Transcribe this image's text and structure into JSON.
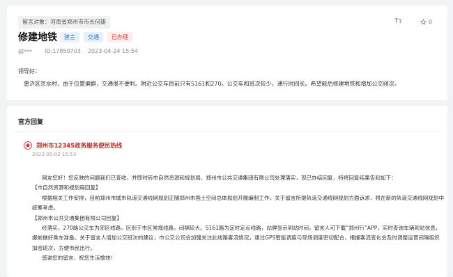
{
  "message": {
    "target": "留言对象：河南省郑州市市长何雄",
    "title": "修建地铁",
    "tags": [
      "建言",
      "交通",
      "已办理"
    ],
    "font_size_label": "Tт",
    "like_count": "0",
    "user": "郝***",
    "id": "ID:17850703",
    "datetime": "2023-04-24 15:54",
    "greeting": "领导好：",
    "content": "惠济区京水村，由于位置偏僻，交通很不便利。附近公交车目前只有S161和270。公交车和班次较少，通行时间长。希望能后修建地铁和增加公交频次。"
  },
  "reply": {
    "section_title": "官方回复",
    "org": "郑州市12345政务服务便民热线",
    "date": "2023-05-02 15:53",
    "paragraphs": [
      "网友您好！您反映的问题我们已查收，并即时转市自然资源和规划局、郑州市公共交通集团有限公司处理落实，现已办结回复，特将回复结果告知如下：",
      "【市自然资源和规划局回复】",
      "根据相关工作安排，目前郑州市城市轨道交通线网规划正随郑州市国土空间总体规划开展编制工作，关于留言所提轨道交通线网规划方面诉求，将在新的轨道交通线网规划中统筹考虑。",
      "【郑州市公共交通集团有限公司回复】",
      "经落实，270路公交车为郊区线路，区别于市区常规线路，间隔较大。S161路为定时定点线路，站牌显示到站时间，留言人可下载“郑州行”APP，实时查询车辆到站信息，提前做好乘车准备。关于留言人增加公交班次的建议，市公交公司会加强关注此线路客流情况，通过GPS智能调度与现场调度密切配合，根据客流变化会及时调整运营间隔组织加密班次，方便市民出行。",
      "感谢您的留言，祝您生活愉快！"
    ]
  },
  "colors": {
    "background": "#f2f3f5",
    "brand_red": "#c62828",
    "tag_blue": "#3a78d6",
    "tag_red": "#e0433c"
  }
}
